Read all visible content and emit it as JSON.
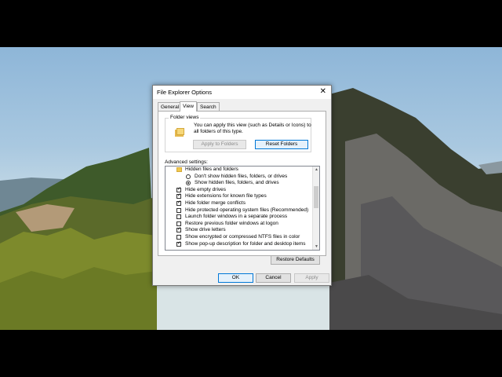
{
  "dialog": {
    "title": "File Explorer Options",
    "tabs": [
      "General",
      "View",
      "Search"
    ],
    "active_tab": "View"
  },
  "folder_views": {
    "group_label": "Folder views",
    "description": "You can apply this view (such as Details or Icons) to all folders of this type.",
    "apply_button": "Apply to Folders",
    "reset_button": "Reset Folders"
  },
  "advanced": {
    "label": "Advanced settings:",
    "items": [
      {
        "type": "folder",
        "label": "Hidden files and folders"
      },
      {
        "type": "radio",
        "checked": false,
        "label": "Don't show hidden files, folders, or drives"
      },
      {
        "type": "radio",
        "checked": true,
        "label": "Show hidden files, folders, and drives"
      },
      {
        "type": "checkbox",
        "checked": true,
        "label": "Hide empty drives"
      },
      {
        "type": "checkbox",
        "checked": true,
        "label": "Hide extensions for known file types"
      },
      {
        "type": "checkbox",
        "checked": true,
        "label": "Hide folder merge conflicts"
      },
      {
        "type": "checkbox",
        "checked": false,
        "label": "Hide protected operating system files (Recommended)"
      },
      {
        "type": "checkbox",
        "checked": false,
        "label": "Launch folder windows in a separate process"
      },
      {
        "type": "checkbox",
        "checked": false,
        "label": "Restore previous folder windows at logon"
      },
      {
        "type": "checkbox",
        "checked": true,
        "label": "Show drive letters"
      },
      {
        "type": "checkbox",
        "checked": false,
        "label": "Show encrypted or compressed NTFS files in color"
      },
      {
        "type": "checkbox",
        "checked": true,
        "label": "Show pop-up description for folder and desktop items"
      }
    ],
    "restore_button": "Restore Defaults"
  },
  "footer": {
    "ok": "OK",
    "cancel": "Cancel",
    "apply": "Apply"
  },
  "icons": {
    "close": "close-icon",
    "folder": "folder-icon",
    "scroll_up": "chevron-up-icon",
    "scroll_down": "chevron-down-icon"
  }
}
